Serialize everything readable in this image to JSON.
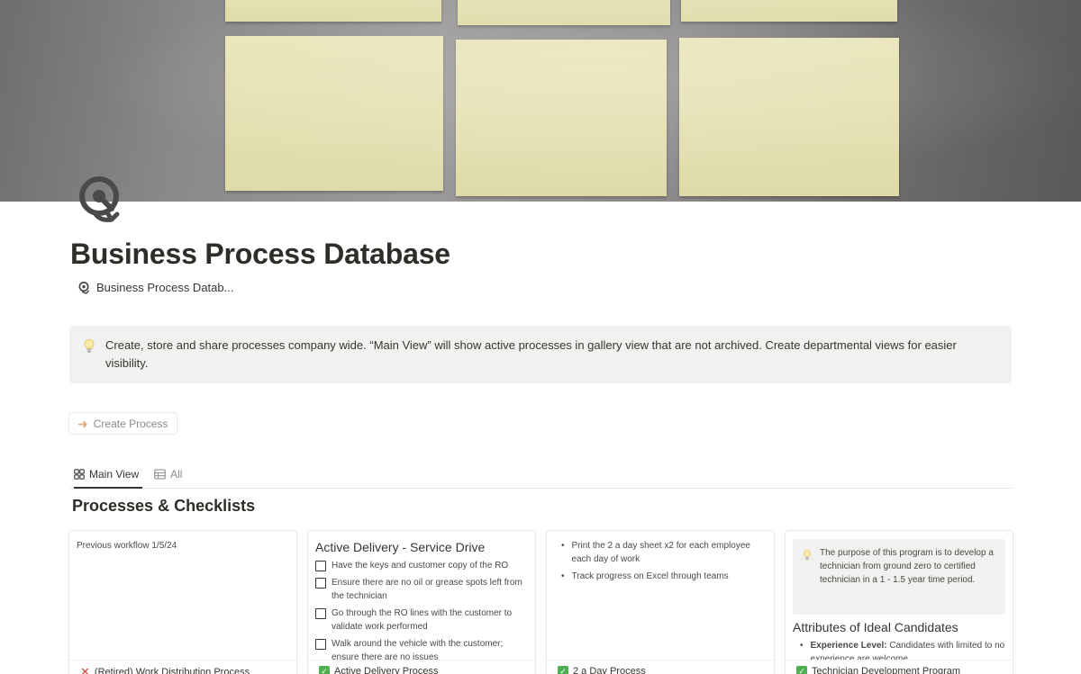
{
  "page": {
    "title": "Business Process Database",
    "breadcrumb": "Business Process Datab..."
  },
  "callout": {
    "text": "Create, store and share processes company wide. “Main View” will show active processes in gallery view that are not archived. Create departmental views for easier visibility."
  },
  "actions": {
    "create_label": "Create Process"
  },
  "views": [
    {
      "label": "Main View",
      "icon": "gallery-icon",
      "active": true
    },
    {
      "label": "All",
      "icon": "table-icon",
      "active": false
    }
  ],
  "section": {
    "title": "Processes & Checklists"
  },
  "cards": [
    {
      "preview_text": "Previous workflow 1/5/24",
      "status_icon": "x-icon",
      "title": "(Retired) Work Distribution Process"
    },
    {
      "heading": "Active Delivery - Service Drive",
      "checklist": [
        "Have the keys and customer copy of the RO",
        "Ensure there are no oil or grease spots left from the technician",
        "Go through the RO lines with the customer to validate work performed",
        "Walk around the vehicle with the customer; ensure there are no issues"
      ],
      "status_icon": "check-icon",
      "title": "Active Delivery Process"
    },
    {
      "bullets": [
        "Print the 2 a day sheet x2 for each employee each day of work",
        "Track progress on Excel through teams"
      ],
      "status_icon": "check-icon",
      "title": "2 a Day Process"
    },
    {
      "callout_text": "The purpose of this program is to develop a technician from ground zero to certified technician in a 1 - 1.5 year time period.",
      "heading": "Attributes of Ideal Candidates",
      "bullet_bold": "Experience Level:",
      "bullet_text": " Candidates with limited to no experience are welcome.",
      "status_icon": "check-icon",
      "title": "Technician Development Program"
    }
  ],
  "colors": {
    "text": "#37352f",
    "callout_bg": "#f1f1ef",
    "note": "#e3e0b0",
    "check_green": "#4caf50",
    "x_red": "#d93f32"
  }
}
